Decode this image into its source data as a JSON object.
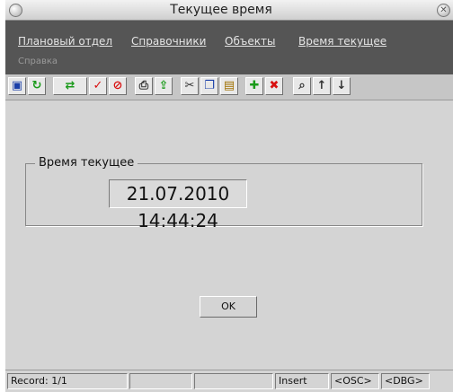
{
  "window": {
    "title": "Текущее время"
  },
  "menu": {
    "items": [
      "Плановый отдел",
      "Справочники",
      "Объекты",
      "Время текущее"
    ],
    "help": "Справка"
  },
  "toolbar": {
    "icons": [
      "save-icon",
      "refresh-icon",
      "connect-icon",
      "check-icon",
      "cancel-icon",
      "print-icon",
      "export-icon",
      "cut-icon",
      "copy-icon",
      "paste-icon",
      "add-icon",
      "delete-icon",
      "find-icon",
      "up-arrow-icon",
      "down-arrow-icon"
    ],
    "colors": {
      "green": "#1a9a1a",
      "red": "#d81010",
      "blue": "#1a3fa8"
    }
  },
  "group": {
    "label": "Время текущее",
    "time_value": "21.07.2010 14:44:24"
  },
  "ok_label": "OK",
  "status": {
    "record": "Record: 1/1",
    "mode": "Insert",
    "osc": "<OSC>",
    "dbg": "<DBG>"
  }
}
